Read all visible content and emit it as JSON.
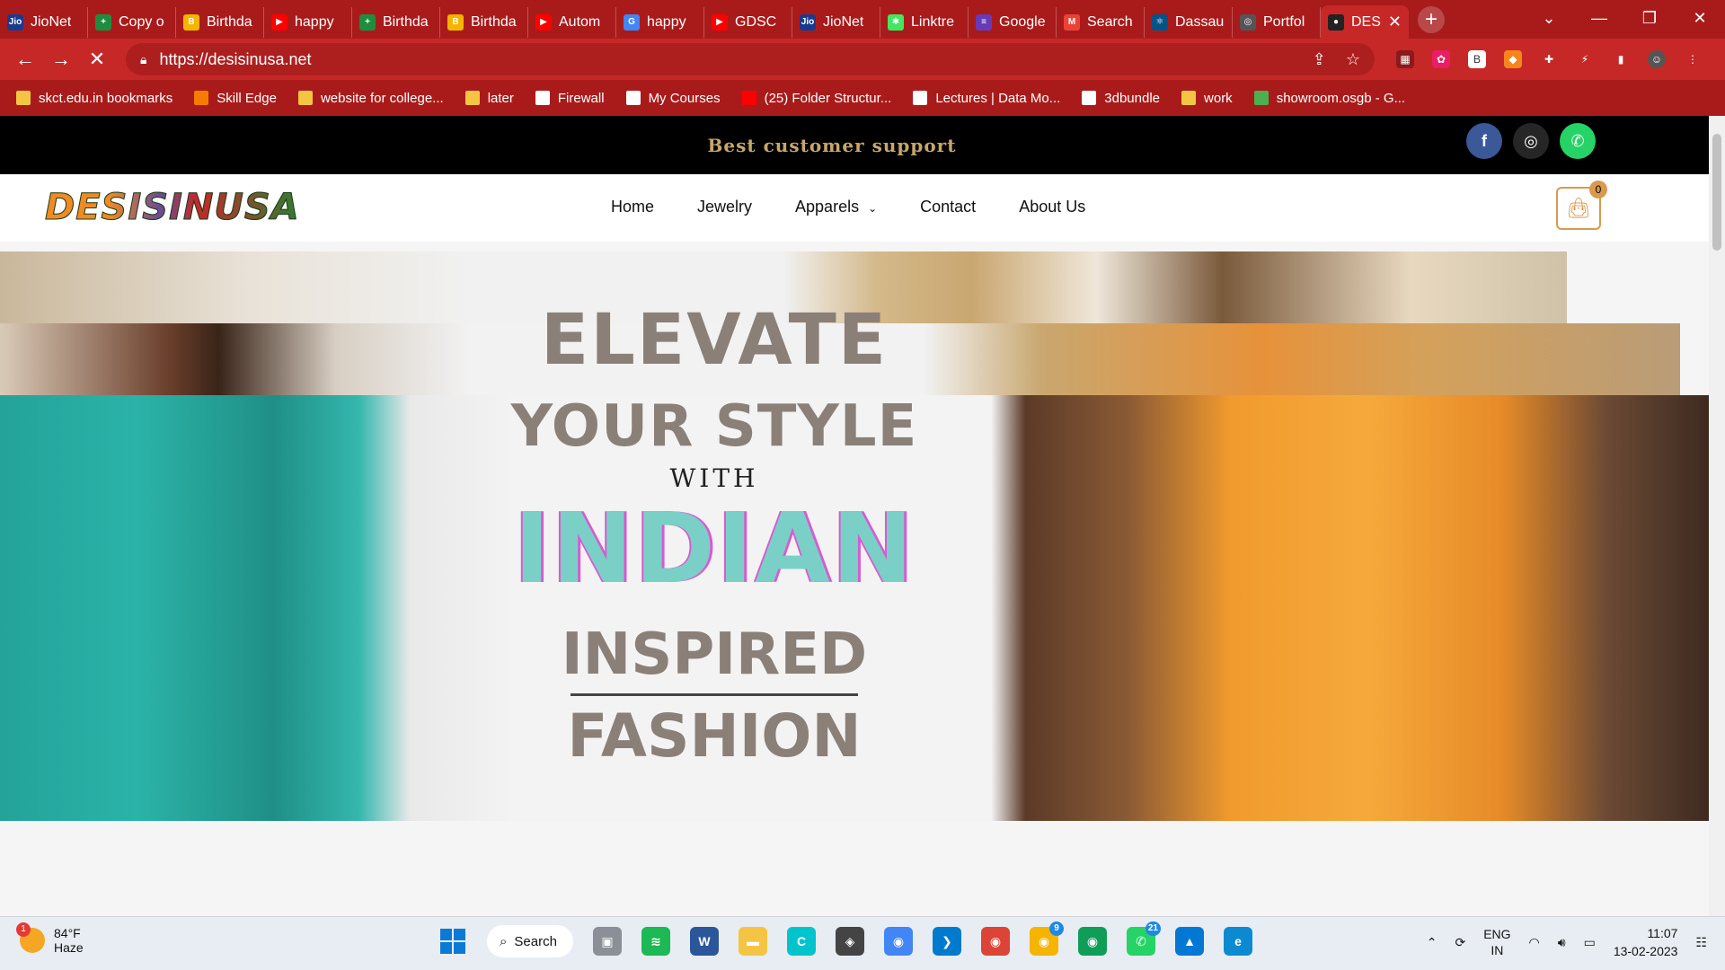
{
  "browser": {
    "tabs": [
      {
        "title": "JioNet",
        "color": "#1a3a8f",
        "glyph": "Jio"
      },
      {
        "title": "Copy o",
        "color": "#1e8e3e",
        "glyph": "+"
      },
      {
        "title": "Birthda",
        "color": "#f4b400",
        "glyph": "B"
      },
      {
        "title": "happy",
        "color": "#ff0000",
        "glyph": "▶"
      },
      {
        "title": "Birthda",
        "color": "#1e8e3e",
        "glyph": "+"
      },
      {
        "title": "Birthda",
        "color": "#f4b400",
        "glyph": "B"
      },
      {
        "title": "Autom",
        "color": "#ff0000",
        "glyph": "▶"
      },
      {
        "title": "happy",
        "color": "#4285f4",
        "glyph": "G"
      },
      {
        "title": "GDSC",
        "color": "#ff0000",
        "glyph": "▶"
      },
      {
        "title": "JioNet",
        "color": "#1a3a8f",
        "glyph": "Jio"
      },
      {
        "title": "Linktre",
        "color": "#43e660",
        "glyph": "✱"
      },
      {
        "title": "Google",
        "color": "#673ab7",
        "glyph": "≡"
      },
      {
        "title": "Search",
        "color": "#ea4335",
        "glyph": "M"
      },
      {
        "title": "Dassau",
        "color": "#005386",
        "glyph": "⚛"
      },
      {
        "title": "Portfol",
        "color": "#555555",
        "glyph": "◎"
      }
    ],
    "active_tab": {
      "title": "DES",
      "close": "✕"
    },
    "new_tab": "+",
    "window": {
      "minimize": "—",
      "maximize": "❐",
      "close": "✕",
      "dropdown": "⌄"
    },
    "url": "https://desisinusa.net",
    "nav": {
      "back": "←",
      "forward": "→",
      "stop": "✕"
    },
    "bookmarks": [
      {
        "label": "skct.edu.in bookmarks",
        "color": "#f4c542"
      },
      {
        "label": "Skill Edge",
        "color": "#f57c00"
      },
      {
        "label": "website for college...",
        "color": "#f4c542"
      },
      {
        "label": "later",
        "color": "#f4c542"
      },
      {
        "label": "Firewall",
        "color": "#ffffff"
      },
      {
        "label": "My Courses",
        "color": "#ffffff"
      },
      {
        "label": "(25) Folder Structur...",
        "color": "#ff0000"
      },
      {
        "label": "Lectures | Data Mo...",
        "color": "#ffffff"
      },
      {
        "label": "3dbundle",
        "color": "#ffffff"
      },
      {
        "label": "work",
        "color": "#f4c542"
      },
      {
        "label": "showroom.osgb - G...",
        "color": "#4caf50"
      }
    ]
  },
  "site": {
    "topbar_text": "Best customer support",
    "socials": [
      {
        "name": "facebook",
        "color": "#3b5998",
        "glyph": "f"
      },
      {
        "name": "instagram",
        "color": "#262626",
        "glyph": "◎"
      },
      {
        "name": "whatsapp",
        "color": "#25d366",
        "glyph": "✆"
      }
    ],
    "logo": "DESISINUSA",
    "menu": [
      "Home",
      "Jewelry",
      "Apparels",
      "Contact",
      "About Us"
    ],
    "apparels_chevron": "⌄",
    "cart_count": "0",
    "hero": {
      "line1": "ELEVATE",
      "line2": "YOUR STYLE",
      "line3": "WITH",
      "line4": "INDIAN",
      "line5": "INSPIRED",
      "line6": "FASHION"
    }
  },
  "taskbar": {
    "weather": {
      "temp": "84°F",
      "condition": "Haze",
      "badge": "1"
    },
    "search": "Search",
    "apps": [
      {
        "name": "file-manager",
        "color": "#8a8f98",
        "glyph": "▣",
        "badge": ""
      },
      {
        "name": "spotify",
        "color": "#1db954",
        "glyph": "≋",
        "badge": ""
      },
      {
        "name": "word-app",
        "color": "#2b579a",
        "glyph": "W",
        "badge": ""
      },
      {
        "name": "file-explorer",
        "color": "#f6c443",
        "glyph": "▬",
        "badge": ""
      },
      {
        "name": "canva",
        "color": "#00c4cc",
        "glyph": "C",
        "badge": ""
      },
      {
        "name": "unity",
        "color": "#444444",
        "glyph": "◈",
        "badge": ""
      },
      {
        "name": "chrome",
        "color": "#4285f4",
        "glyph": "◉",
        "badge": ""
      },
      {
        "name": "vscode",
        "color": "#007acc",
        "glyph": "❯",
        "badge": ""
      },
      {
        "name": "chrome-profile",
        "color": "#db4437",
        "glyph": "◉",
        "badge": ""
      },
      {
        "name": "chrome-profile-2",
        "color": "#f4b400",
        "glyph": "◉",
        "badge": "9"
      },
      {
        "name": "chrome-profile-3",
        "color": "#0f9d58",
        "glyph": "◉",
        "badge": ""
      },
      {
        "name": "whatsapp",
        "color": "#25d366",
        "glyph": "✆",
        "badge": "21"
      },
      {
        "name": "photos",
        "color": "#0078d4",
        "glyph": "▲",
        "badge": ""
      },
      {
        "name": "edge",
        "color": "#0c8ad1",
        "glyph": "e",
        "badge": ""
      }
    ],
    "tray": {
      "lang1": "ENG",
      "lang2": "IN",
      "time": "11:07",
      "date": "13-02-2023"
    }
  }
}
